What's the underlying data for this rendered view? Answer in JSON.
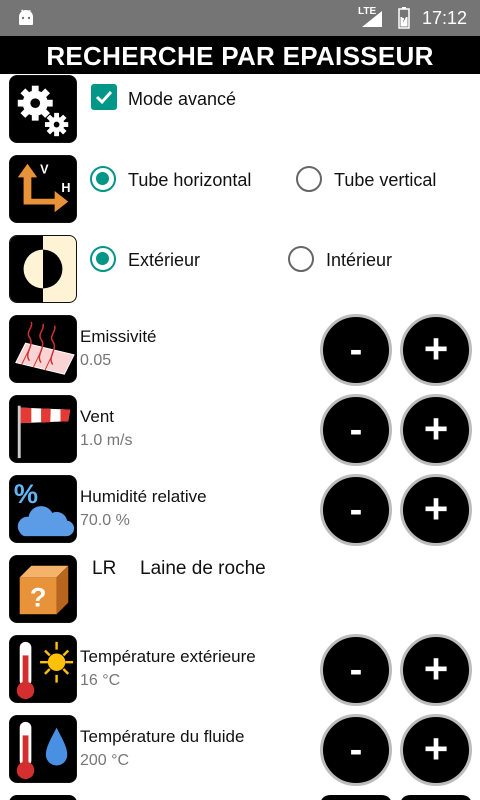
{
  "status_bar": {
    "network": "LTE",
    "time": "17:12"
  },
  "title": "RECHERCHE PAR EPAISSEUR",
  "mode": {
    "label": "Mode avancé",
    "checked": true
  },
  "orientation": {
    "options": [
      "Tube horizontal",
      "Tube vertical"
    ],
    "selected": "Tube horizontal",
    "icon_letters": {
      "vertical": "V",
      "horizontal": "H"
    }
  },
  "side": {
    "options": [
      "Extérieur",
      "Intérieur"
    ],
    "selected": "Extérieur"
  },
  "params": [
    {
      "label": "Emissivité",
      "value": "0.05",
      "icon": "emissivity-icon"
    },
    {
      "label": "Vent",
      "value": "1.0 m/s",
      "icon": "windsock-icon"
    },
    {
      "label": "Humidité relative",
      "value": "70.0 %",
      "icon": "humidity-icon",
      "icon_text": "%"
    },
    {
      "label": "Température extérieure",
      "value": "16 °C",
      "icon": "thermometer-sun-icon"
    },
    {
      "label": "Température du fluide",
      "value": "200 °C",
      "icon": "thermometer-drop-icon"
    }
  ],
  "insulation": {
    "code": "LR",
    "name": "Laine de roche",
    "icon_text": "?"
  },
  "buttons": {
    "minus": "-",
    "plus": "+"
  },
  "colors": {
    "accent": "#009688",
    "header": "#000000",
    "statusbar": "#757575",
    "icon_orange": "#E8923A"
  }
}
